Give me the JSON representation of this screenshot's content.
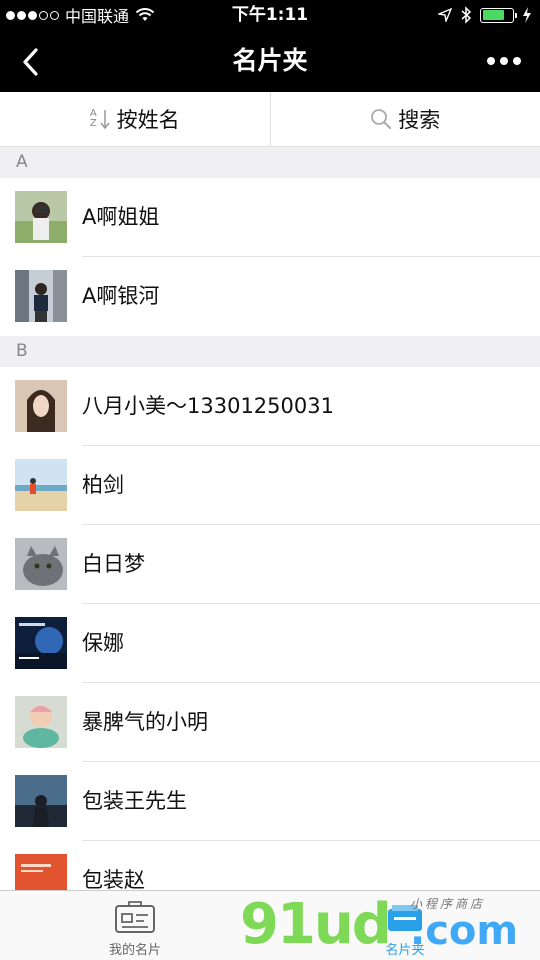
{
  "status_bar": {
    "carrier": "中国联通",
    "time": "下午1:11",
    "signal_dots_filled": 3,
    "signal_dots_total": 5,
    "battery_level": 0.75,
    "icons": [
      "wifi-icon",
      "location-arrow-icon",
      "bluetooth-icon",
      "charging-bolt-icon"
    ]
  },
  "nav": {
    "title": "名片夹",
    "back_icon": "chevron-left-icon",
    "more_icon": "more-dots-icon"
  },
  "toolbar": {
    "sort_label": "按姓名",
    "sort_icon": "az-sort-icon",
    "search_label": "搜索",
    "search_icon": "search-icon"
  },
  "sections": [
    {
      "letter": "A",
      "contacts": [
        {
          "name": "A啊姐姐"
        },
        {
          "name": "A啊银河"
        }
      ]
    },
    {
      "letter": "B",
      "contacts": [
        {
          "name": "八月小美～13301250031"
        },
        {
          "name": "柏剑"
        },
        {
          "name": "白日梦"
        },
        {
          "name": "保娜"
        },
        {
          "name": "暴脾气的小明"
        },
        {
          "name": "包装王先生"
        },
        {
          "name": "包装赵"
        }
      ]
    }
  ],
  "tabs": [
    {
      "label": "我的名片",
      "icon": "business-card-icon",
      "active": false
    },
    {
      "label": "名片夹",
      "icon": "card-holder-icon",
      "active": true
    }
  ],
  "watermark": {
    "main": "91ud",
    "com": ".com",
    "sub": "小程序商店"
  },
  "colors": {
    "nav_bg": "#000000",
    "section_bg": "#efeff4",
    "active_tab": "#2aa0e8",
    "battery": "#4cd964",
    "watermark_green": "#7ed957",
    "watermark_blue": "#3fa9f5"
  }
}
